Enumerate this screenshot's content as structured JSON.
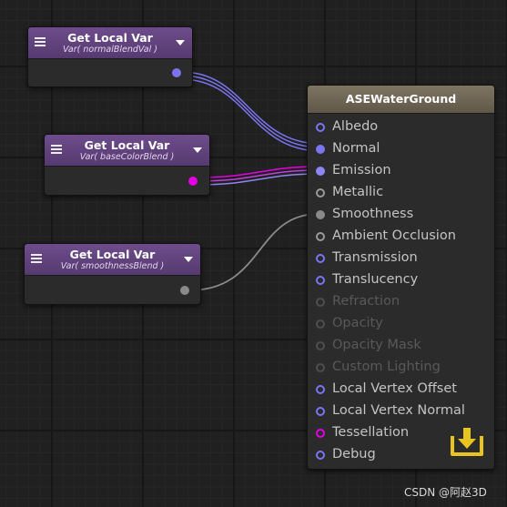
{
  "var_nodes": [
    {
      "title": "Get Local Var",
      "subtitle": "Var( normalBlendVal )",
      "port_color": "#7b74f0"
    },
    {
      "title": "Get Local Var",
      "subtitle": "Var( baseColorBlend )",
      "port_color": "#e400e4"
    },
    {
      "title": "Get Local Var",
      "subtitle": "Var( smoothnessBlend )",
      "port_color": "#8a8a8a"
    }
  ],
  "master": {
    "title": "ASEWaterGround",
    "inputs": [
      {
        "label": "Albedo",
        "style": "ring",
        "color": "#7b74f0",
        "enabled": true
      },
      {
        "label": "Normal",
        "style": "dot",
        "color": "#7b74f0",
        "enabled": true
      },
      {
        "label": "Emission",
        "style": "dot",
        "color": "#8e86f2",
        "enabled": true
      },
      {
        "label": "Metallic",
        "style": "ring",
        "color": "#9a9a9a",
        "enabled": true
      },
      {
        "label": "Smoothness",
        "style": "dot",
        "color": "#8a8a8a",
        "enabled": true
      },
      {
        "label": "Ambient Occlusion",
        "style": "ring",
        "color": "#9a9a9a",
        "enabled": true
      },
      {
        "label": "Transmission",
        "style": "ring",
        "color": "#7b74f0",
        "enabled": true
      },
      {
        "label": "Translucency",
        "style": "ring",
        "color": "#7b74f0",
        "enabled": true
      },
      {
        "label": "Refraction",
        "style": "ring",
        "color": "#4e4e4e",
        "enabled": false
      },
      {
        "label": "Opacity",
        "style": "ring",
        "color": "#4e4e4e",
        "enabled": false
      },
      {
        "label": "Opacity Mask",
        "style": "ring",
        "color": "#4e4e4e",
        "enabled": false
      },
      {
        "label": "Custom Lighting",
        "style": "ring",
        "color": "#4e4e4e",
        "enabled": false
      },
      {
        "label": "Local Vertex Offset",
        "style": "ring",
        "color": "#7b74f0",
        "enabled": true
      },
      {
        "label": "Local Vertex Normal",
        "style": "ring",
        "color": "#7b74f0",
        "enabled": true
      },
      {
        "label": "Tessellation",
        "style": "ring",
        "color": "#e400e4",
        "enabled": true
      },
      {
        "label": "Debug",
        "style": "ring",
        "color": "#7b74f0",
        "enabled": true
      }
    ],
    "icon": "download-tray-icon",
    "icon_color": "#e8c420"
  },
  "wire_colors": {
    "normal": "#7b74f0",
    "emission": "#cf3bd9",
    "smoothness": "#8a8a8a"
  },
  "watermark": "CSDN @阿赵3D"
}
